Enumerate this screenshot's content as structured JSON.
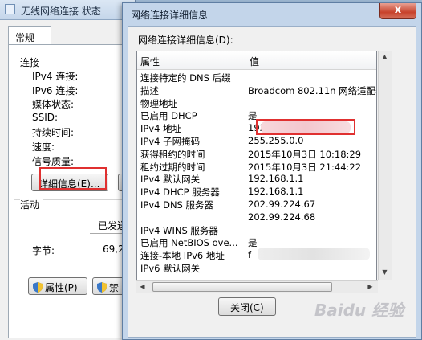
{
  "bg_window": {
    "title": "无线网络连接 状态",
    "tab": "常规",
    "connection_section": "连接",
    "labels": [
      "IPv4 连接:",
      "IPv6 连接:",
      "媒体状态:",
      "SSID:",
      "持续时间:",
      "速度:"
    ],
    "signal_quality": "信号质量:",
    "details_button": "详细信息(E)...",
    "activity_section": "活动",
    "sent_label": "已发送",
    "bytes_label": "字节:",
    "bytes_value": "69,2",
    "properties_button": "属性(P)",
    "disable_button": "禁"
  },
  "dialog": {
    "title": "网络连接详细信息",
    "close_glyph": "x",
    "list_label": "网络连接详细信息(D):",
    "columns": [
      "属性",
      "值"
    ],
    "rows": [
      {
        "prop": "连接特定的 DNS 后缀",
        "val": ""
      },
      {
        "prop": "描述",
        "val": "Broadcom 802.11n 网络适配器 #2"
      },
      {
        "prop": "物理地址",
        "val": ""
      },
      {
        "prop": "已启用 DHCP",
        "val": "是"
      },
      {
        "prop": "IPv4 地址",
        "val": "192.168.1.104"
      },
      {
        "prop": "IPv4 子网掩码",
        "val": "255.255.0.0"
      },
      {
        "prop": "获得租约的时间",
        "val": "2015年10月3日 10:18:29"
      },
      {
        "prop": "租约过期的时间",
        "val": "2015年10月3日 21:44:22"
      },
      {
        "prop": "IPv4 默认网关",
        "val": "192.168.1.1"
      },
      {
        "prop": "IPv4 DHCP 服务器",
        "val": "192.168.1.1"
      },
      {
        "prop": "IPv4 DNS 服务器",
        "val": "202.99.224.67"
      },
      {
        "prop": "",
        "val": "202.99.224.68"
      },
      {
        "prop": "IPv4 WINS 服务器",
        "val": ""
      },
      {
        "prop": "已启用 NetBIOS ove...",
        "val": "是"
      },
      {
        "prop": "连接-本地 IPv6 地址",
        "val": "f"
      },
      {
        "prop": "IPv6 默认网关",
        "val": ""
      }
    ],
    "close_button": "关闭(C)",
    "scroll_up": "▲",
    "scroll_down": "▼",
    "scroll_left": "◀",
    "scroll_right": "▶"
  },
  "watermark": "Baidu 经验",
  "colors": {
    "highlight": "#e03030",
    "title_bar": "#c3d5ea"
  }
}
